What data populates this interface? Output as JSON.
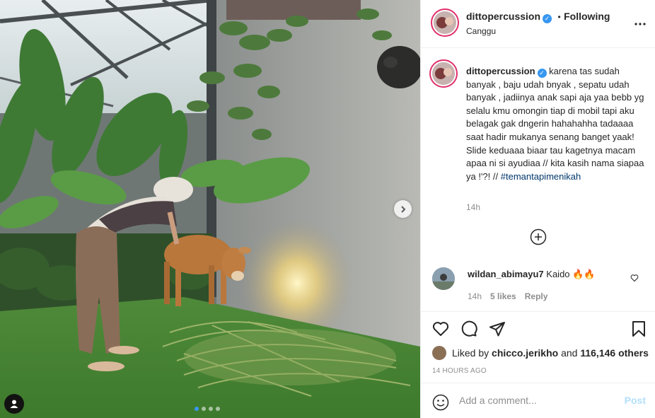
{
  "post": {
    "username": "dittopercussion",
    "separator": "•",
    "follow_status": "Following",
    "location": "Canggu",
    "more_icon": "more-horizontal-icon",
    "carousel": {
      "slide_index": 1,
      "slide_count": 4,
      "next_icon": "chevron-right-icon",
      "tag_icon": "user-tag-icon"
    }
  },
  "caption": {
    "username": "dittopercussion",
    "text": "karena tas sudah banyak , baju udah bnyak , sepatu udah banyak , jadiinya anak sapi aja yaa bebb yg selalu kmu omongin tiap di mobil tapi aku belagak gak dngerin hahahahha tadaaaa saat hadir mukanya senang banget yaak! Slide keduaaa biaar tau kagetnya macam apaa ni si ayudiaa // kita kasih nama siapaa ya !'?! //",
    "hashtag": "#temantapimenikah",
    "time": "14h"
  },
  "load_more_icon": "plus-circle-icon",
  "comments": [
    {
      "username": "wildan_abimayu7",
      "text": "Kaido 🔥🔥",
      "time": "14h",
      "likes": "5 likes",
      "reply": "Reply"
    }
  ],
  "actions": {
    "like_icon": "heart-icon",
    "comment_icon": "comment-icon",
    "share_icon": "share-icon",
    "save_icon": "bookmark-icon"
  },
  "likes": {
    "prefix": "Liked by",
    "user": "chicco.jerikho",
    "joiner": "and",
    "others": "116,146 others"
  },
  "posted_ago": "14 HOURS AGO",
  "comment_box": {
    "placeholder": "Add a comment...",
    "post_label": "Post",
    "emoji_icon": "emoji-icon"
  },
  "colors": {
    "accent": "#3897f0",
    "post_disabled": "#b2dffc",
    "hashtag": "#00376b",
    "story_ring": "#e1306c"
  }
}
